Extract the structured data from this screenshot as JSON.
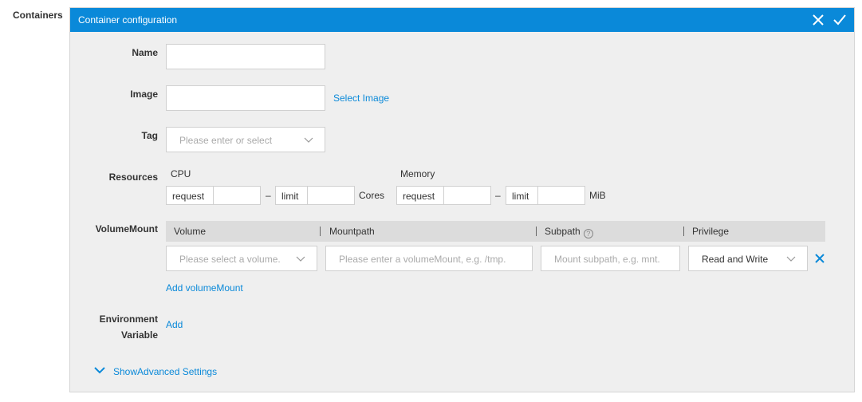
{
  "section_label": "Containers",
  "panel": {
    "title": "Container configuration",
    "close_icon": "close-icon",
    "confirm_icon": "check-icon",
    "accent_color": "#0a89d9"
  },
  "name": {
    "label": "Name",
    "value": ""
  },
  "image": {
    "label": "Image",
    "value": "",
    "select_link": "Select Image"
  },
  "tag": {
    "label": "Tag",
    "placeholder": "Please enter or select"
  },
  "resources": {
    "label": "Resources",
    "cpu": {
      "title": "CPU",
      "request": "request",
      "limit": "limit",
      "unit": "Cores",
      "dash": "–"
    },
    "memory": {
      "title": "Memory",
      "request": "request",
      "limit": "limit",
      "unit": "MiB",
      "dash": "–"
    }
  },
  "volume_mount": {
    "label": "VolumeMount",
    "columns": [
      "Volume",
      "Mountpath",
      "Subpath",
      "Privilege"
    ],
    "row": {
      "volume_placeholder": "Please select a volume.",
      "mountpath_placeholder": "Please enter a volumeMount, e.g. /tmp.",
      "subpath_placeholder": "Mount subpath, e.g. mnt.",
      "privilege_value": "Read and Write"
    },
    "add_link": "Add volumeMount"
  },
  "env": {
    "label_line1": "Environment",
    "label_line2": "Variable",
    "add_link": "Add"
  },
  "advanced": {
    "link": "ShowAdvanced Settings"
  }
}
